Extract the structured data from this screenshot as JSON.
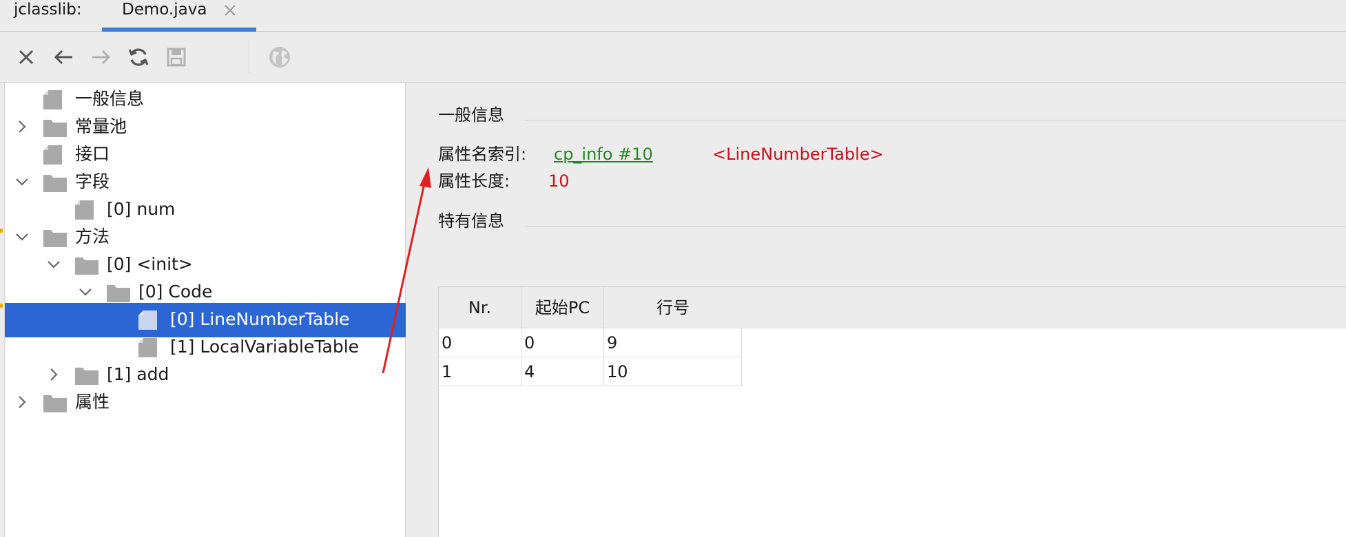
{
  "tabbar": {
    "prefix": "jclasslib:",
    "active_tab": "Demo.java"
  },
  "toolbar": {
    "buttons": [
      "close-icon",
      "back-arrow-icon",
      "forward-arrow-icon",
      "refresh-icon",
      "save-icon",
      "globe-icon"
    ]
  },
  "tree": {
    "items": [
      {
        "label": "一般信息"
      },
      {
        "label": "常量池"
      },
      {
        "label": "接口"
      },
      {
        "label": "字段"
      },
      {
        "label": "[0] num"
      },
      {
        "label": "方法"
      },
      {
        "label": "[0] <init>"
      },
      {
        "label": "[0] Code"
      },
      {
        "label": "[0] LineNumberTable"
      },
      {
        "label": "[1] LocalVariableTable"
      },
      {
        "label": "[1] add"
      },
      {
        "label": "属性"
      }
    ]
  },
  "detail": {
    "general_title": "一般信息",
    "name_index_label": "属性名索引:",
    "name_index_link": "cp_info #10",
    "name_index_value": "<LineNumberTable>",
    "length_label": "属性长度:",
    "length_value": "10",
    "specific_title": "特有信息",
    "table": {
      "headers": [
        "Nr.",
        "起始PC",
        "行号"
      ],
      "rows": [
        [
          "0",
          "0",
          "9"
        ],
        [
          "1",
          "4",
          "10"
        ]
      ]
    }
  },
  "colors": {
    "selection": "#2c66d4",
    "tab_underline": "#3d7fd5",
    "link": "#1f8a1f",
    "value_red": "#c8101a",
    "annotation_arrow": "#e02020"
  }
}
